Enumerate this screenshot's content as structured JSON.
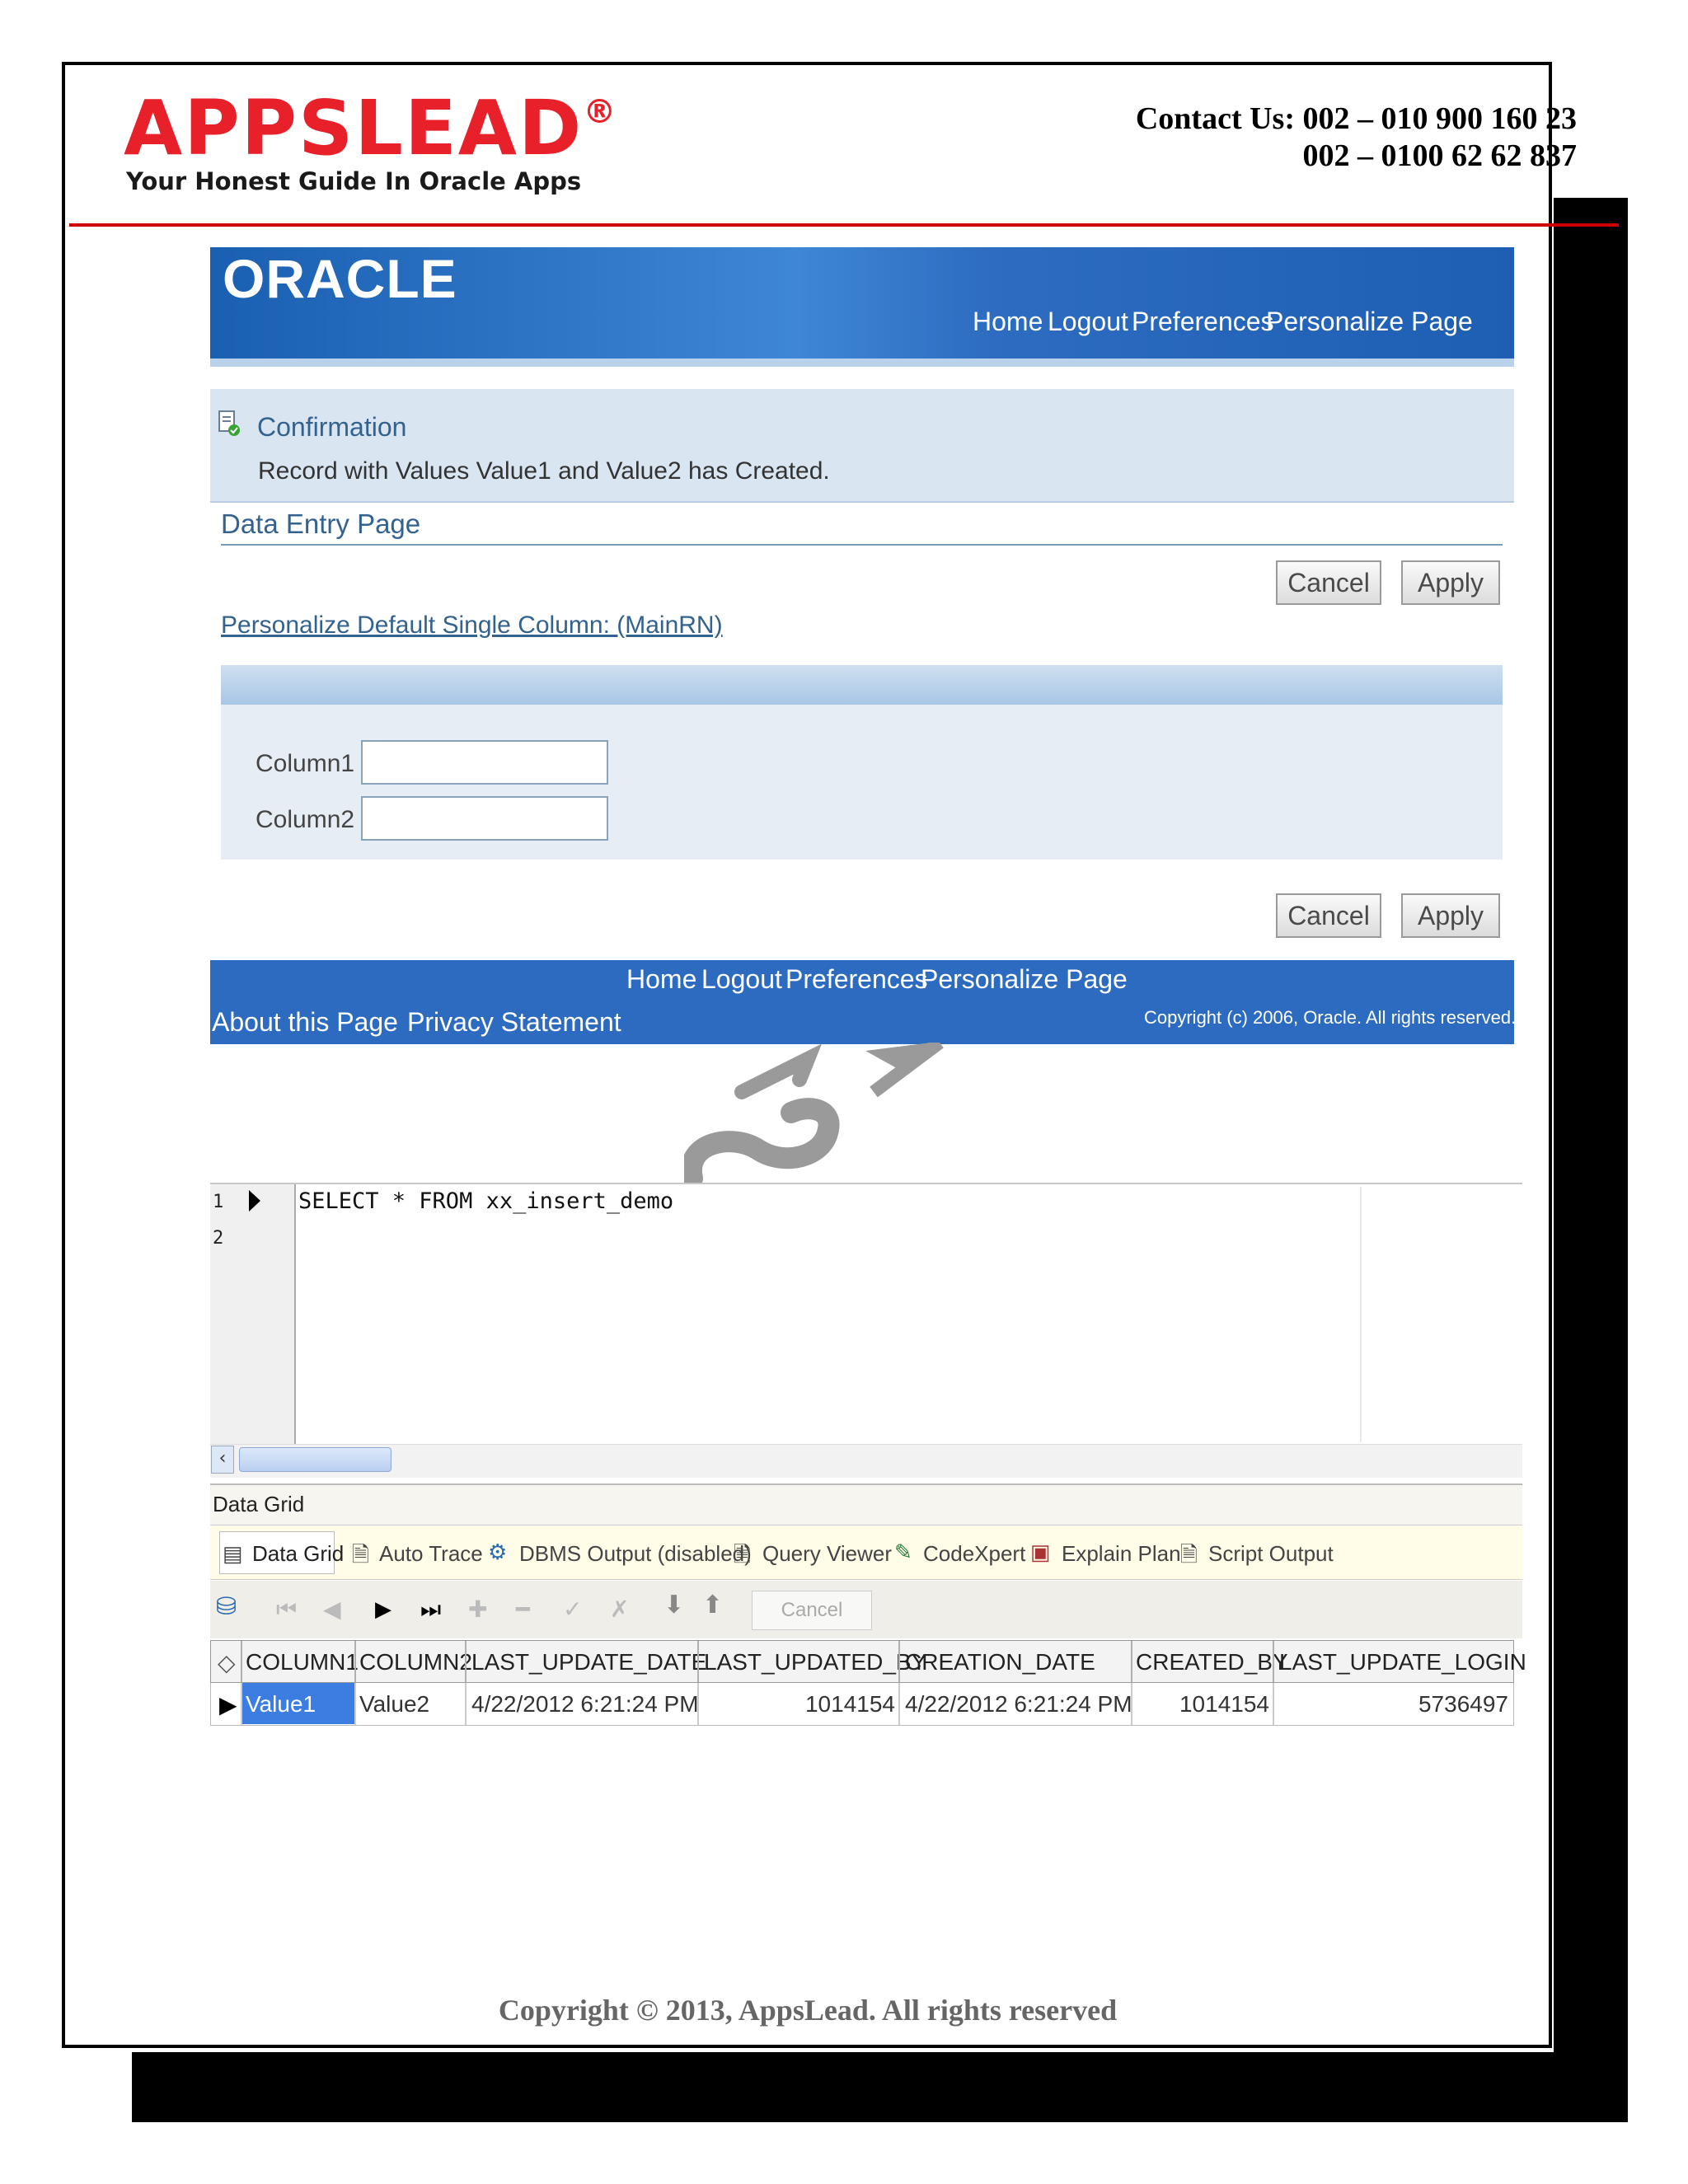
{
  "header": {
    "logo": "APPSLEAD",
    "logo_mark": "®",
    "tagline": "Your Honest Guide In Oracle Apps",
    "contact_line1": "Contact Us: 002 – 010 900 160 23",
    "contact_line2": "002 – 0100 62 62 837"
  },
  "oracle": {
    "logo": "ORACLE",
    "nav": [
      "Home",
      "Logout",
      "Preferences",
      "Personalize Page"
    ]
  },
  "confirmation": {
    "title": "Confirmation",
    "message": "Record with Values Value1 and Value2 has Created."
  },
  "data_entry": {
    "title": "Data Entry Page",
    "cancel_label": "Cancel",
    "apply_label": "Apply",
    "personalize_link": "Personalize Default Single Column: (MainRN)",
    "fields": [
      {
        "label": "Column1",
        "value": ""
      },
      {
        "label": "Column2",
        "value": ""
      }
    ]
  },
  "footer": {
    "nav": [
      "Home",
      "Logout",
      "Preferences",
      "Personalize Page"
    ],
    "about": "About this Page",
    "privacy": "Privacy Statement",
    "copyright": "Copyright (c) 2006, Oracle. All rights reserved."
  },
  "sql_editor": {
    "line_numbers": [
      "1",
      "2"
    ],
    "lines": [
      "SELECT * FROM xx_insert_demo",
      ""
    ]
  },
  "results": {
    "panel_label": "Data Grid",
    "tabs": [
      "Data Grid",
      "Auto Trace",
      "DBMS Output (disabled)",
      "Query Viewer",
      "CodeXpert",
      "Explain Plan",
      "Script Output"
    ],
    "cancel_label": "Cancel",
    "columns": [
      "COLUMN1",
      "COLUMN2",
      "LAST_UPDATE_DATE",
      "LAST_UPDATED_BY",
      "CREATION_DATE",
      "CREATED_BY",
      "LAST_UPDATE_LOGIN"
    ],
    "rows": [
      [
        "Value1",
        "Value2",
        "4/22/2012 6:21:24 PM",
        "1014154",
        "4/22/2012 6:21:24 PM",
        "1014154",
        "5736497"
      ]
    ]
  },
  "page_copyright": "Copyright © 2013, AppsLead. All rights reserved",
  "colors": {
    "brand_red": "#e8202a",
    "oracle_blue": "#2c6bc0",
    "link_blue": "#33628f"
  }
}
